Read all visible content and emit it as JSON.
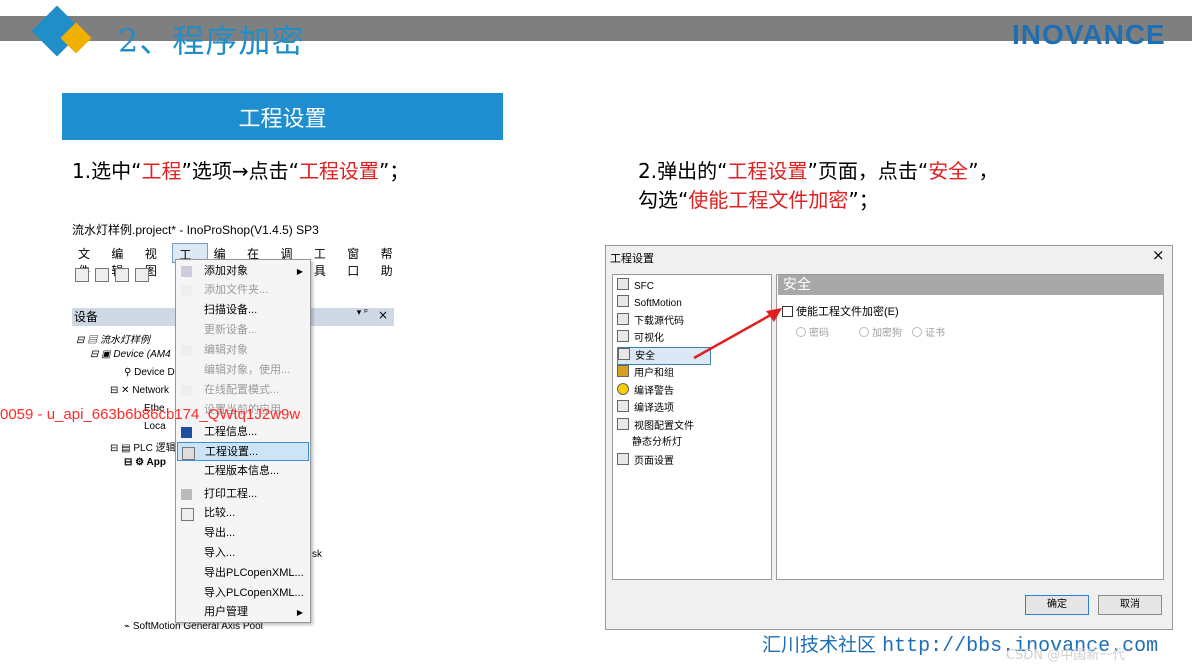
{
  "slide": {
    "title": "2、程序加密",
    "logo": "INOVANCE",
    "section_label": "工程设置",
    "step1": {
      "pre": "1.选中“",
      "hl1": "工程",
      "mid": "”选项→点击“",
      "hl2": "工程设置",
      "post": "”；"
    },
    "step2": {
      "pre": "2.弹出的“",
      "hl1": "工程设置",
      "mid": "”页面，点击“",
      "hl2": "安全",
      "post": "”，",
      "line2_pre": "勾选“",
      "hl3": "使能工程文件加密",
      "line2_post": "”；"
    },
    "footer_text": "汇川技术社区",
    "footer_url": "http://bbs.inovance.com",
    "csdn": "CSDN @中国新一代",
    "accent_color": "#1f8ec9",
    "highlight_color": "#e02020"
  },
  "ide": {
    "window_title": "流水灯样例.project* - InoProShop(V1.4.5) SP3",
    "menu": [
      "文件",
      "编辑",
      "视图",
      "工程",
      "编译",
      "在线",
      "调试",
      "工具",
      "窗口",
      "帮助"
    ],
    "devices_pane": "设备",
    "tree": [
      "流水灯样例",
      "Device (AM4",
      "Device D",
      "Network",
      "Ethe",
      "Loca",
      "PLC 逻辑",
      "App",
      "sk",
      "SoftMotion General Axis Pool"
    ],
    "dropdown": [
      {
        "label": "添加对象",
        "disabled": false,
        "submenu": true
      },
      {
        "label": "添加文件夹...",
        "disabled": true
      },
      {
        "label": "扫描设备...",
        "disabled": false
      },
      {
        "label": "更新设备...",
        "disabled": true
      },
      {
        "label": "编辑对象",
        "disabled": true
      },
      {
        "label": "编辑对象，使用...",
        "disabled": true
      },
      {
        "label": "在线配置模式...",
        "disabled": true
      },
      {
        "label": "设置当前的应用",
        "disabled": true
      },
      {
        "label": "工程信息...",
        "disabled": false
      },
      {
        "label": "工程设置...",
        "disabled": false,
        "highlight": true
      },
      {
        "label": "工程版本信息...",
        "disabled": false
      },
      {
        "label": "打印工程...",
        "disabled": false
      },
      {
        "label": "比较...",
        "disabled": false
      },
      {
        "label": "导出...",
        "disabled": false
      },
      {
        "label": "导入...",
        "disabled": false
      },
      {
        "label": "导出PLCopenXML...",
        "disabled": false
      },
      {
        "label": "导入PLCopenXML...",
        "disabled": false
      },
      {
        "label": "用户管理",
        "disabled": false,
        "submenu": true
      }
    ],
    "watermark": "0059 - u_api_663b6b86cb174_QWtq1J2w9w"
  },
  "dialog": {
    "title": "工程设置",
    "close": "×",
    "categories": [
      "SFC",
      "SoftMotion",
      "下载源代码",
      "可视化",
      "安全",
      "用户和组",
      "编译警告",
      "编译选项",
      "视图配置文件",
      "静态分析灯",
      "页面设置"
    ],
    "selected_category": "安全",
    "section_header": "安全",
    "checkbox_label": "使能工程文件加密(E)",
    "radios": [
      "密码",
      "加密狗",
      "证书"
    ],
    "ok": "确定",
    "cancel": "取消"
  }
}
